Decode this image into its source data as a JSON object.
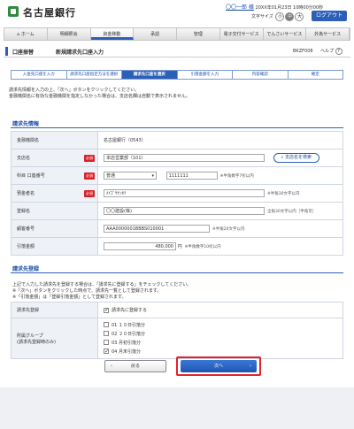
{
  "header": {
    "bank_name": "名古屋銀行",
    "user_name": "〇〇一郎 様",
    "last_login": "20XX年01月23日 10時00分00秒",
    "font_size_label": "文字サイズ",
    "font_sizes": [
      "小",
      "中",
      "大"
    ],
    "font_size_selected": "中",
    "logout_label": "ログアウト"
  },
  "global_nav": {
    "items": [
      "ホーム",
      "明細照会",
      "資金移動",
      "承認",
      "管理",
      "電子交付サービス",
      "でんさいサービス",
      "外為サービス"
    ],
    "active": "資金移動"
  },
  "page": {
    "category": "口座振替",
    "title": "新規請求先口座入力",
    "screen_code": "BKZF008",
    "help_label": "ヘルプ",
    "help_icon": "question-icon"
  },
  "steps": {
    "items": [
      "入金先口座を入力",
      "請求先口座指定方法を選択",
      "請求先口座を選択",
      "引落金額を入力",
      "内容確認",
      "確定"
    ],
    "active_index": 2
  },
  "intro": {
    "line1": "請求先情報を入力の上、「次へ」ボタンをクリックしてください。",
    "line2": "金融機関名に有効な金融機関を指定しなかった場合は、支店名欄は自動で表示されません。"
  },
  "section_info": {
    "title": "請求先情報",
    "required_label": "必須",
    "rows": {
      "bank": {
        "label": "金融機関名",
        "value": "名古屋銀行（0543）"
      },
      "branch": {
        "label": "支店名",
        "value": "本店営業部（101）",
        "button": "支店名を検索"
      },
      "account": {
        "label": "科目 口座番号",
        "type_value": "普通",
        "number_value": "1111111",
        "note": "※半角数字7桁以内"
      },
      "holder": {
        "label": "預金者名",
        "value": "ﾒｲｺﾞﾔｹﾝｾﾂ",
        "note": "※半角30文字以内"
      },
      "reg_name": {
        "label": "登録名",
        "value": "〇〇建設(株)",
        "note": "全角30文字以内［半角可］"
      },
      "customer_no": {
        "label": "顧客番号",
        "value": "AAA0000001BBBS010001",
        "note": "※半角20文字以内"
      },
      "amount": {
        "label": "引落金額",
        "value": "480,000",
        "unit": "円",
        "note": "※半角数字10桁以内"
      }
    }
  },
  "section_reg": {
    "title": "請求先登録",
    "intro_line1": "上記で入力した請求先を登録する場合は、「請求先に登録する」をチェックしてください。",
    "intro_line2": "※「次へ」ボタンをクリックした時点で、請求先一覧として登録されます。",
    "intro_line3": "※「引落金額」は「登録引落金額」として登録されます。",
    "register": {
      "label": "請求先登録",
      "option": "請求先に登録する",
      "checked": true
    },
    "groups": {
      "label_line1": "所属グループ",
      "label_line2": "(請求先登録時のみ)",
      "options": [
        {
          "label": "01 １０日引落分",
          "checked": false
        },
        {
          "label": "02 ２０日引落分",
          "checked": false
        },
        {
          "label": "03 月初引落分",
          "checked": false
        },
        {
          "label": "04 月末引落分",
          "checked": true
        }
      ]
    }
  },
  "buttons": {
    "back_label": "戻る",
    "next_label": "次へ",
    "highlight_color": "#e0242b"
  }
}
